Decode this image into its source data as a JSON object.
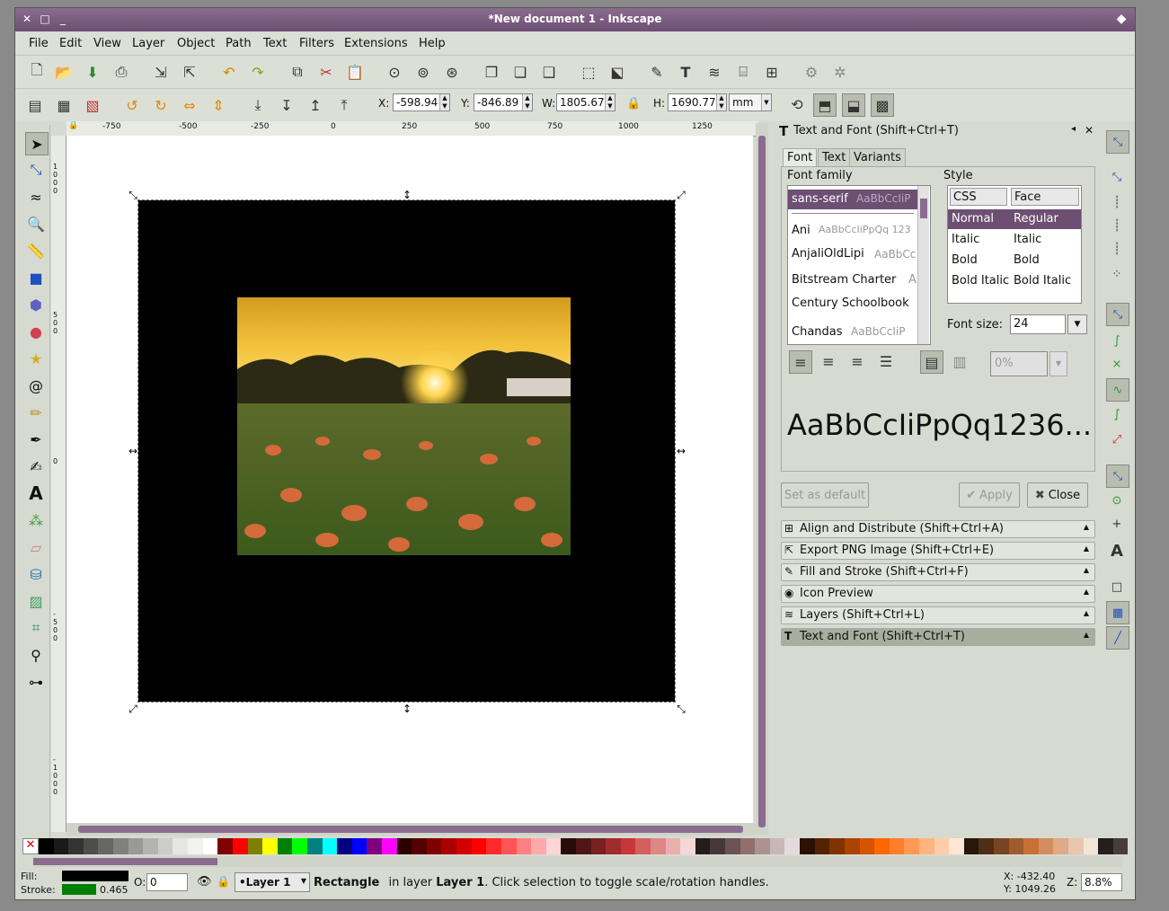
{
  "window": {
    "title": "*New document 1 - Inkscape"
  },
  "menu": [
    "File",
    "Edit",
    "View",
    "Layer",
    "Object",
    "Path",
    "Text",
    "Filters",
    "Extensions",
    "Help"
  ],
  "toolbar": {
    "x_label": "X:",
    "x_value": "-598.94",
    "y_label": "Y:",
    "y_value": "-846.89",
    "w_label": "W:",
    "w_value": "1805.67",
    "h_label": "H:",
    "h_value": "1690.77",
    "unit": "mm"
  },
  "ruler": {
    "top": [
      "-750",
      "-500",
      "-250",
      "0",
      "250",
      "500",
      "750",
      "1000",
      "1250"
    ],
    "left": [
      "1000",
      "500",
      "0",
      "-500",
      "-1000"
    ]
  },
  "panel": {
    "title": "Text and Font (Shift+Ctrl+T)",
    "tabs": [
      "Font",
      "Text",
      "Variants"
    ],
    "font_family_label": "Font family",
    "families": [
      {
        "name": "sans-serif",
        "sample": "AaBbCcIiP"
      },
      {
        "name": "Ani",
        "sample": "AaBbCcIiPpQq 123"
      },
      {
        "name": "AnjaliOldLipi",
        "sample": "AaBbCc"
      },
      {
        "name": "Bitstream Charter",
        "sample": "A"
      },
      {
        "name": "Century Schoolbook",
        "sample": ""
      },
      {
        "name": "Chandas",
        "sample": "AaBbCcIiP"
      }
    ],
    "style_label": "Style",
    "style_cols": [
      "CSS",
      "Face"
    ],
    "styles": [
      {
        "css": "Normal",
        "face": "Regular"
      },
      {
        "css": "Italic",
        "face": "Italic"
      },
      {
        "css": "Bold",
        "face": "Bold"
      },
      {
        "css": "Bold Italic",
        "face": "Bold Italic"
      }
    ],
    "font_size_label": "Font size:",
    "font_size": "24",
    "spacing": "0%",
    "preview": "AaBbCcIiPpQq1236...",
    "set_default": "Set as default",
    "apply": "Apply",
    "close": "Close",
    "docks": [
      "Align and Distribute (Shift+Ctrl+A)",
      "Export PNG Image (Shift+Ctrl+E)",
      "Fill and Stroke (Shift+Ctrl+F)",
      "Icon Preview",
      "Layers (Shift+Ctrl+L)",
      "Text and Font (Shift+Ctrl+T)"
    ]
  },
  "palette": [
    "#000000",
    "#1a1a1a",
    "#333333",
    "#4d4d4d",
    "#666666",
    "#808080",
    "#999999",
    "#b3b3b3",
    "#cccccc",
    "#e6e6e6",
    "#f2f2f2",
    "#ffffff",
    "#800000",
    "#ff0000",
    "#808000",
    "#ffff00",
    "#008000",
    "#00ff00",
    "#008080",
    "#00ffff",
    "#000080",
    "#0000ff",
    "#800080",
    "#ff00ff",
    "#2b0000",
    "#550000",
    "#800000",
    "#aa0000",
    "#d40000",
    "#ff0000",
    "#ff2a2a",
    "#ff5555",
    "#ff8080",
    "#ffaaaa",
    "#ffd5d5",
    "#280b0b",
    "#501616",
    "#782121",
    "#a02c2c",
    "#c83737",
    "#d35f5f",
    "#de8787",
    "#e9afaf",
    "#f4d7d7",
    "#241c1c",
    "#483737",
    "#6c5353",
    "#916f6f",
    "#ac9393",
    "#c8b7b7",
    "#e3dbdb",
    "#2b1100",
    "#552200",
    "#803300",
    "#aa4400",
    "#d45500",
    "#ff6600",
    "#ff7f2a",
    "#ff9955",
    "#ffb380",
    "#ffccaa",
    "#ffe6d5",
    "#28170b",
    "#502d16",
    "#784421",
    "#a05a2c",
    "#c87137",
    "#d38d5f",
    "#deaa87",
    "#e9c6af",
    "#f4e3d7",
    "#241f1c",
    "#483e37"
  ],
  "status": {
    "fill_label": "Fill:",
    "stroke_label": "Stroke:",
    "stroke_width": "0.465",
    "opacity_label": "O:",
    "opacity": "0",
    "layer": "•Layer 1",
    "message_bold1": "Rectangle",
    "message_mid": "in layer",
    "message_bold2": "Layer 1",
    "message_end": ". Click selection to toggle scale/rotation handles.",
    "coord_x": "X: -432.40",
    "coord_y": "Y: 1049.26",
    "zoom_label": "Z:",
    "zoom": "8.8%"
  },
  "colors": {
    "titlebar": "#6d4f73",
    "accent": "#8a6c8f",
    "fill": "#000000",
    "stroke": "#008000"
  }
}
